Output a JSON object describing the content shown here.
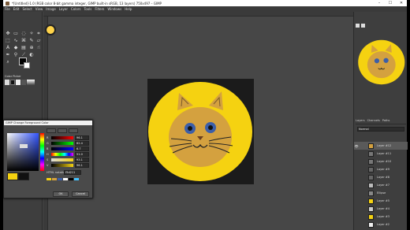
{
  "window": {
    "title": "*[Untitled]-1.0 (RGB color 8-bit gamma integer, GIMP built-in sRGB, 13 layers) 750x497 – GIMP",
    "min": "–",
    "max": "☐",
    "close": "✕"
  },
  "menu": [
    "File",
    "Edit",
    "Select",
    "View",
    "Image",
    "Layer",
    "Colors",
    "Tools",
    "Filters",
    "Windows",
    "Help"
  ],
  "dialog": {
    "title": "GIMP Change Foreground Color",
    "hex_label": "HTML notation",
    "hex_value": "f5d211",
    "ok_label": "OK",
    "cancel_label": "Cancel",
    "channels": [
      "R",
      "G",
      "B",
      "H",
      "S",
      "V"
    ],
    "values": [
      "96.1",
      "82.4",
      "6.7",
      "51.0",
      "93.1",
      "96.1"
    ]
  },
  "toolbox": {
    "options_title": "Color Picker",
    "icons": [
      "move-icon",
      "rect-select-icon",
      "lasso-icon",
      "fuzzy-select-icon",
      "crop-icon",
      "unified-transform-icon",
      "warp-icon",
      "cage-icon",
      "text-icon",
      "bucket-fill-icon",
      "gradient-icon",
      "paintbrush-icon",
      "eraser-icon",
      "clone-icon",
      "smudge-icon",
      "paths-icon",
      "color-picker-icon",
      "measure-icon",
      "zoom-icon",
      "dodge-icon"
    ]
  },
  "layers": {
    "tabs": [
      "Layers",
      "Channels",
      "Paths"
    ],
    "mode": "Normal",
    "items": [
      "Layer #12",
      "Layer #11",
      "Layer #10",
      "Layer #9",
      "Layer #8",
      "Layer #7",
      "Ellipse",
      "Layer #5",
      "Layer #4",
      "Layer #3",
      "Layer #2"
    ]
  },
  "colors": {
    "accent": "#f5d211",
    "catFace": "#d4a13f",
    "catEye": "#3d5fa8",
    "canvasBg": "#1b1b1b"
  }
}
